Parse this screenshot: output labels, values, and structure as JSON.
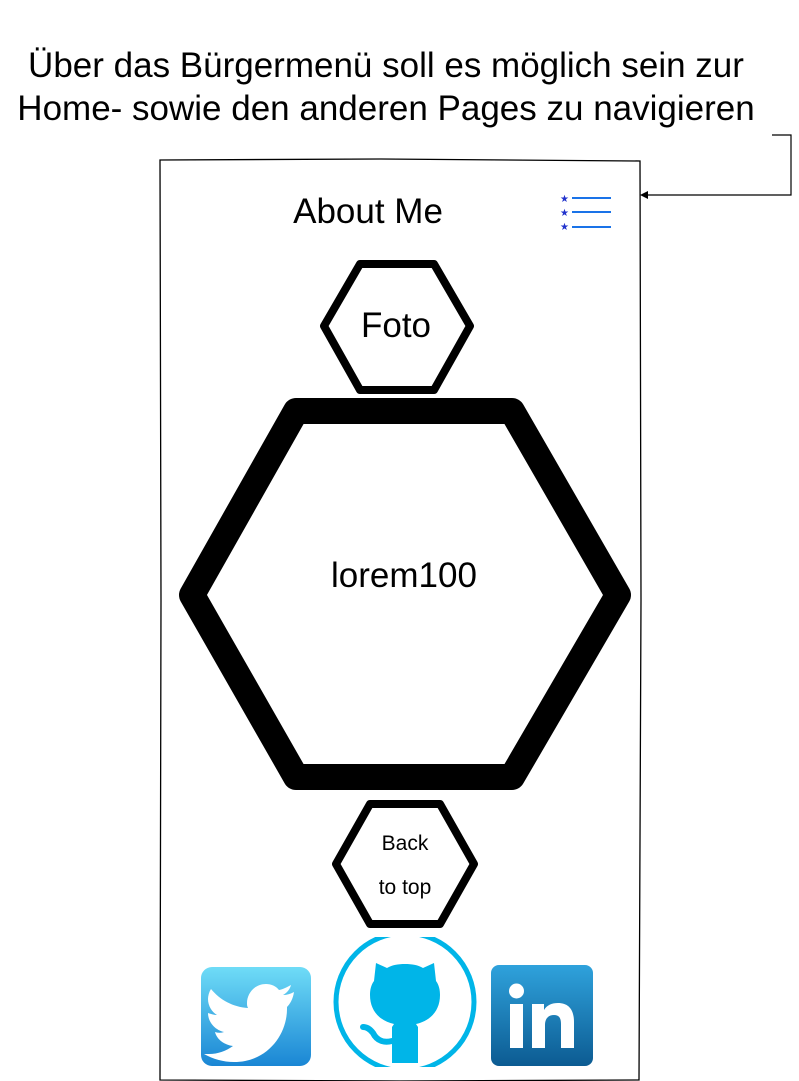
{
  "annotation": {
    "line1": "Über das Bürgermenü soll es möglich sein zur",
    "line2": "Home- sowie den anderen Pages zu navigieren"
  },
  "header": {
    "title": "About Me",
    "menu_icon": "hamburger-menu-icon"
  },
  "photo_hex": {
    "label": "Foto"
  },
  "content_hex": {
    "label": "lorem100"
  },
  "back_to_top": {
    "line1": "Back",
    "line2": "to top"
  },
  "social": [
    {
      "name": "Twitter",
      "icon": "twitter-icon"
    },
    {
      "name": "GitHub",
      "icon": "github-icon"
    },
    {
      "name": "LinkedIn",
      "icon": "linkedin-icon"
    }
  ],
  "colors": {
    "stroke": "#000000",
    "menu_lines": "#1a73e8",
    "menu_stars": "#2233cc",
    "twitter_top": "#5fd3f5",
    "twitter_bottom": "#1a8ad6",
    "github": "#00b5e8",
    "linkedin_top": "#2b9bd6",
    "linkedin_bottom": "#0d5f96"
  }
}
